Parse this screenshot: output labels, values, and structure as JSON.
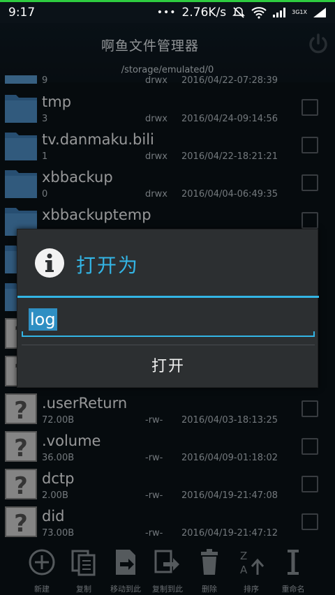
{
  "status_bar": {
    "time": "9:17",
    "net_speed": "2.76K/s",
    "net_labels": [
      "3G",
      "1X"
    ],
    "icons": [
      "dots-icon",
      "mute-icon",
      "wifi-icon",
      "signal-icon",
      "signal-icon"
    ]
  },
  "header": {
    "title": "啊鱼文件管理器",
    "path": "/storage/emulated/0",
    "power_icon": "power-icon"
  },
  "files": [
    {
      "name": "",
      "count": "9",
      "perm": "drwx",
      "date": "2016/04/22-07:28:39",
      "type": "folder"
    },
    {
      "name": "tmp",
      "count": "3",
      "perm": "drwx",
      "date": "2016/04/24-09:14:56",
      "type": "folder"
    },
    {
      "name": "tv.danmaku.bili",
      "count": "1",
      "perm": "drwx",
      "date": "2016/04/22-18:21:21",
      "type": "folder"
    },
    {
      "name": "xbbackup",
      "count": "0",
      "perm": "drwx",
      "date": "2016/04/04-06:49:35",
      "type": "folder"
    },
    {
      "name": "xbbackuptemp",
      "count": "",
      "perm": "",
      "date": "",
      "type": "folder"
    },
    {
      "name": ".userReturn",
      "count": "72.00B",
      "perm": "-rw-",
      "date": "2016/04/03-18:13:25",
      "type": "file"
    },
    {
      "name": ".volume",
      "count": "36.00B",
      "perm": "-rw-",
      "date": "2016/04/09-01:18:02",
      "type": "file"
    },
    {
      "name": "dctp",
      "count": "2.00B",
      "perm": "-rw-",
      "date": "2016/04/19-21:47:08",
      "type": "file"
    },
    {
      "name": "did",
      "count": "73.00B",
      "perm": "-rw-",
      "date": "2016/04/19-21:47:12",
      "type": "file"
    }
  ],
  "dialog": {
    "title": "打开为",
    "icon": "info-icon",
    "input_value": "log",
    "button_label": "打开"
  },
  "toolbar": {
    "items": [
      {
        "label": "新建",
        "icon": "add-icon"
      },
      {
        "label": "复制",
        "icon": "copy-icon"
      },
      {
        "label": "移动到此",
        "icon": "move-icon"
      },
      {
        "label": "复制到此",
        "icon": "copy-to-icon"
      },
      {
        "label": "删除",
        "icon": "trash-icon"
      },
      {
        "label": "排序",
        "icon": "sort-icon"
      },
      {
        "label": "重命名",
        "icon": "rename-icon"
      }
    ]
  },
  "colors": {
    "accent": "#33b5e5",
    "status_line": "#2ecc40",
    "folder": "#4a8cc4"
  }
}
